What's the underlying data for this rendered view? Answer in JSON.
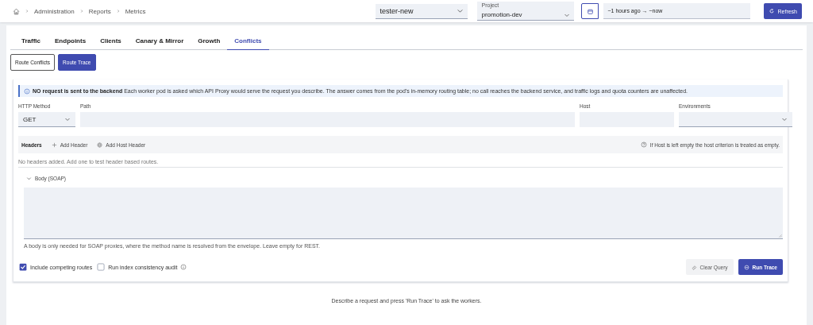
{
  "breadcrumb": [
    "Administration",
    "Reports",
    "Metrics"
  ],
  "toolbar": {
    "workspace": {
      "value": "tester-new"
    },
    "project": {
      "label": "Project",
      "value": "promotion-dev"
    },
    "time_range": {
      "value": "~1 hours ago → ~now"
    },
    "refresh_button": "Refresh"
  },
  "tabs": [
    {
      "label": "Traffic",
      "selected": false
    },
    {
      "label": "Endpoints",
      "selected": false
    },
    {
      "label": "Clients",
      "selected": false
    },
    {
      "label": "Canary & Mirror",
      "selected": false
    },
    {
      "label": "Growth",
      "selected": false
    },
    {
      "label": "Conflicts",
      "selected": true
    }
  ],
  "sub_tabs": [
    {
      "label": "Route Conflicts",
      "selected": false
    },
    {
      "label": "Route Trace",
      "selected": true
    }
  ],
  "notice": {
    "title": "NO request is sent to the backend",
    "text": "Each worker pod is asked which API Proxy would serve the request you describe. The answer comes from the pod's in-memory routing table; no call reaches the backend service, and traffic logs and quota counters are unaffected."
  },
  "fields": [
    {
      "label": "HTTP Method",
      "kind": "select",
      "value": "GET"
    },
    {
      "label": "Path",
      "kind": "text"
    },
    {
      "label": "Host",
      "kind": "text"
    },
    {
      "label": "Environments",
      "kind": "select"
    }
  ],
  "headers": {
    "title": "Headers",
    "actions": [
      {
        "label": "Add Header",
        "kind": "add"
      },
      {
        "label": "Add Host Header",
        "kind": "host"
      }
    ],
    "hint": "If Host is left empty the host criterion is treated as empty.",
    "empty_text": "No headers added. Add one to test header based routes."
  },
  "body": {
    "label": "Body (SOAP)",
    "expanded": true,
    "help": "A body is only needed for SOAP proxies, where the method name is resolved from the envelope. Leave empty for REST."
  },
  "options": [
    {
      "label": "Include competing routes",
      "checked": true,
      "info": false
    },
    {
      "label": "Run index consistency audit",
      "checked": false,
      "info": true
    }
  ],
  "buttons": [
    {
      "label": "Clear Query",
      "kind": "secondary"
    },
    {
      "label": "Run Trace",
      "kind": "primary"
    }
  ],
  "result_hint": "Describe a request and press 'Run Trace' to ask the workers."
}
